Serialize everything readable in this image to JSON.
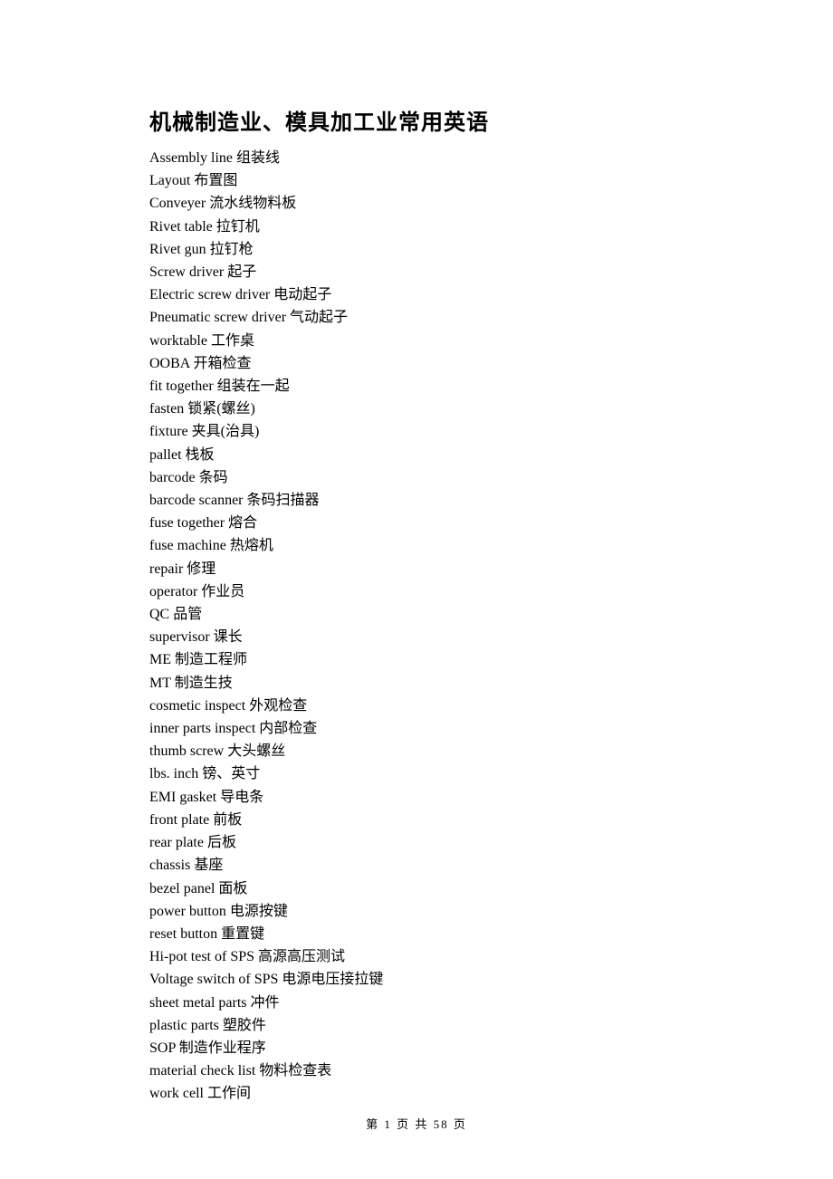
{
  "title": "机械制造业、模具加工业常用英语",
  "entries": [
    "Assembly line 组装线",
    "Layout 布置图",
    "Conveyer 流水线物料板",
    "Rivet table 拉钉机",
    "Rivet gun 拉钉枪",
    "Screw driver 起子",
    "Electric screw driver 电动起子",
    "Pneumatic screw driver 气动起子",
    "worktable  工作桌",
    "OOBA 开箱检查",
    "fit together 组装在一起",
    "fasten 锁紧(螺丝)",
    "fixture  夹具(治具)",
    "pallet 栈板",
    "barcode 条码",
    "barcode scanner 条码扫描器",
    "fuse together 熔合",
    "fuse machine 热熔机",
    "repair 修理",
    "operator 作业员",
    "QC 品管",
    "supervisor  课长",
    "ME 制造工程师",
    "MT 制造生技",
    "cosmetic inspect 外观检查",
    "inner parts inspect 内部检查",
    "thumb screw 大头螺丝",
    "lbs. inch 镑、英寸",
    "EMI gasket 导电条",
    "front plate 前板",
    "rear plate 后板",
    "chassis  基座",
    "bezel panel 面板",
    "power button 电源按键",
    "reset button 重置键",
    "Hi-pot test of SPS 高源高压测试",
    "Voltage switch of SPS  电源电压接拉键",
    "sheet metal parts  冲件",
    "plastic parts 塑胶件",
    "SOP 制造作业程序",
    "material check list 物料检查表",
    "work cell 工作间"
  ],
  "footer": "第 1 页 共 58 页"
}
